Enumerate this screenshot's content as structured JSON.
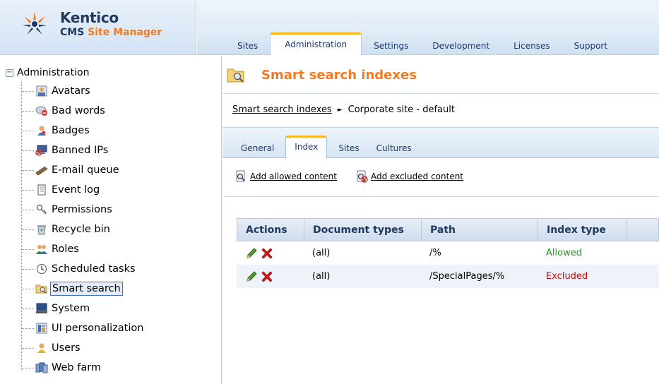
{
  "branding": {
    "line1": "Kentico",
    "line2_prefix": "CMS ",
    "line2_accent": "Site Manager",
    "accent_color": "#f47a20"
  },
  "main_tabs": [
    {
      "label": "Sites",
      "active": false
    },
    {
      "label": "Administration",
      "active": true
    },
    {
      "label": "Settings",
      "active": false
    },
    {
      "label": "Development",
      "active": false
    },
    {
      "label": "Licenses",
      "active": false
    },
    {
      "label": "Support",
      "active": false
    }
  ],
  "tree": {
    "root": {
      "label": "Administration",
      "toggle": "−"
    },
    "items": [
      {
        "label": "Avatars",
        "icon": "avatar-icon"
      },
      {
        "label": "Bad words",
        "icon": "bad-words-icon"
      },
      {
        "label": "Badges",
        "icon": "badges-icon"
      },
      {
        "label": "Banned IPs",
        "icon": "banned-ips-icon"
      },
      {
        "label": "E-mail queue",
        "icon": "email-queue-icon"
      },
      {
        "label": "Event log",
        "icon": "event-log-icon"
      },
      {
        "label": "Permissions",
        "icon": "permissions-icon"
      },
      {
        "label": "Recycle bin",
        "icon": "recycle-bin-icon"
      },
      {
        "label": "Roles",
        "icon": "roles-icon"
      },
      {
        "label": "Scheduled tasks",
        "icon": "scheduled-tasks-icon"
      },
      {
        "label": "Smart search",
        "icon": "smart-search-icon",
        "selected": true
      },
      {
        "label": "System",
        "icon": "system-icon"
      },
      {
        "label": "UI personalization",
        "icon": "ui-personalization-icon"
      },
      {
        "label": "Users",
        "icon": "users-icon"
      },
      {
        "label": "Web farm",
        "icon": "web-farm-icon"
      }
    ]
  },
  "page": {
    "title": "Smart search indexes",
    "breadcrumb": {
      "link": "Smart search indexes",
      "separator": "►",
      "current": "Corporate site - default"
    }
  },
  "sub_tabs": [
    {
      "label": "General",
      "active": false
    },
    {
      "label": "Index",
      "active": true
    },
    {
      "label": "Sites",
      "active": false
    },
    {
      "label": "Cultures",
      "active": false
    }
  ],
  "actions": {
    "add_allowed": "Add allowed content",
    "add_excluded": "Add excluded content"
  },
  "grid": {
    "headers": [
      "Actions",
      "Document types",
      "Path",
      "Index type"
    ],
    "rows": [
      {
        "document_types": "(all)",
        "path": "/%",
        "index_type": "Allowed"
      },
      {
        "document_types": "(all)",
        "path": "/SpecialPages/%",
        "index_type": "Excluded"
      }
    ]
  },
  "colors": {
    "allowed": "#1e9c1e",
    "excluded": "#d80000",
    "active_tab_top": "#f8b81c"
  }
}
